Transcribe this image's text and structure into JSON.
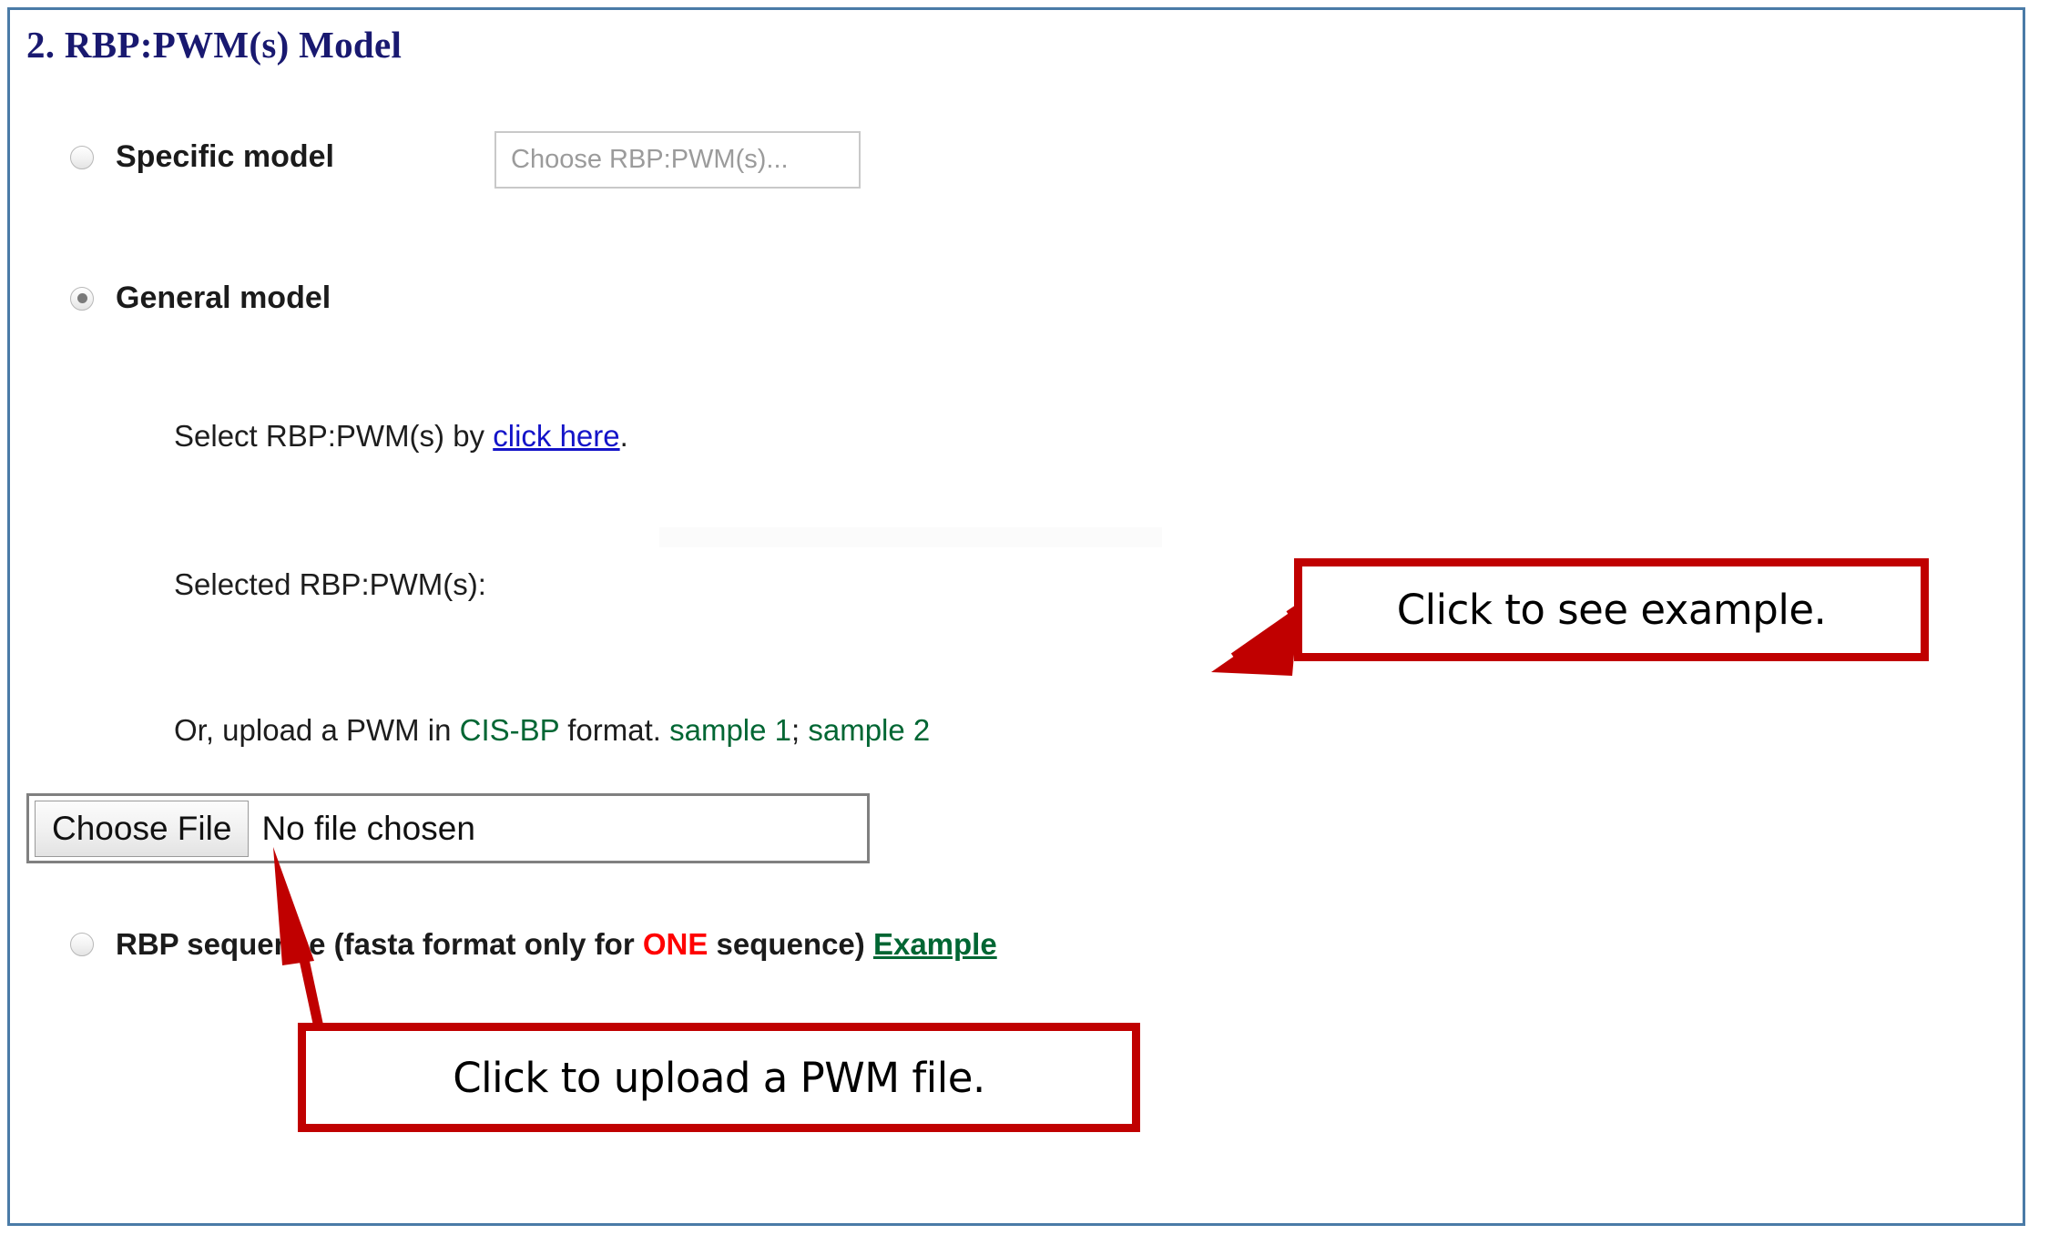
{
  "section": {
    "heading": "2. RBP:PWM(s) Model"
  },
  "options": {
    "specific": {
      "label": "Specific model",
      "checked": false,
      "select_placeholder": "Choose RBP:PWM(s)..."
    },
    "general": {
      "label": "General model",
      "checked": true
    },
    "rbp_sequence": {
      "label_part1": "RBP sequence (fasta format only for ",
      "emphasis": "ONE",
      "label_part2": " sequence) ",
      "example_link": "Example",
      "checked": false
    }
  },
  "general_body": {
    "select_line_prefix": "Select RBP:PWM(s) by ",
    "select_line_link": "click here",
    "select_line_suffix": ".",
    "selected_label": "Selected RBP:PWM(s):",
    "upload_prefix": "Or, upload a PWM in ",
    "upload_format": "CIS-BP",
    "upload_mid": " format. ",
    "sample1": "sample 1",
    "sample_sep": "; ",
    "sample2": "sample 2"
  },
  "file_input": {
    "button_label": "Choose File",
    "status_text": "No file chosen"
  },
  "annotations": {
    "example_callout": "Click to see example.",
    "upload_callout": "Click to upload a PWM file."
  },
  "colors": {
    "panel_border": "#4a7ba7",
    "heading": "#191970",
    "link_blue": "#1414c8",
    "green": "#006633",
    "red": "#ff0000",
    "callout_red": "#c00000"
  }
}
